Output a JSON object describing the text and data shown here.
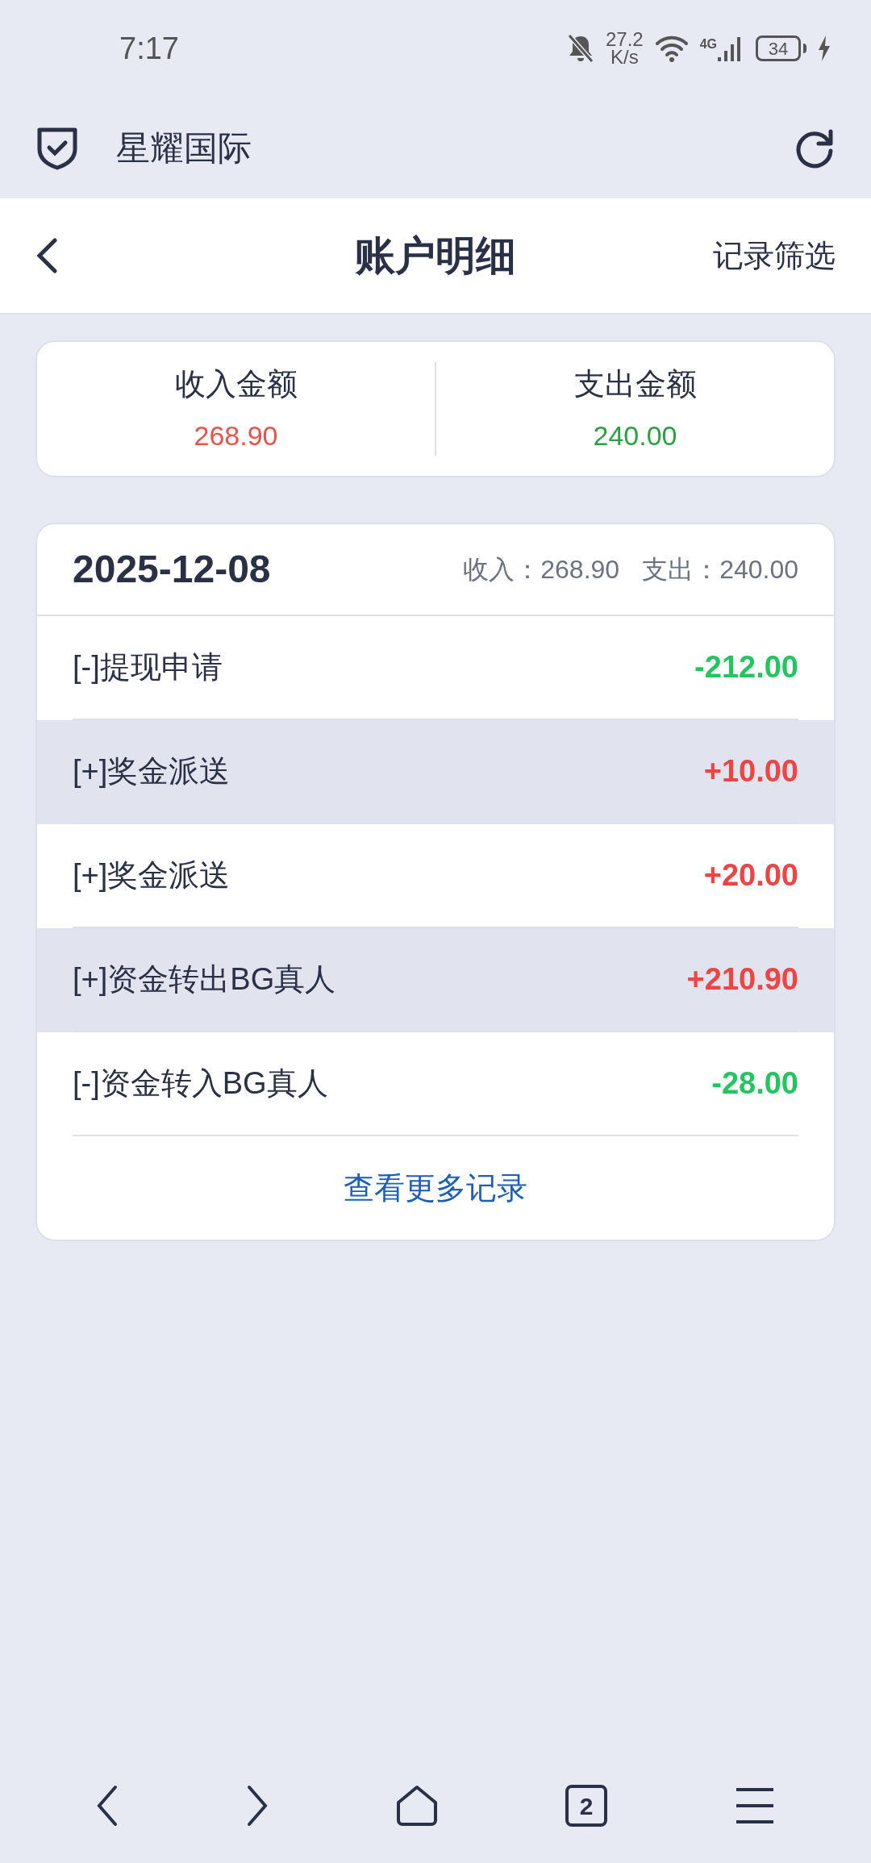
{
  "status_bar": {
    "time": "7:17",
    "speed": "27.2",
    "speed_unit": "K/s",
    "network": "4G",
    "battery": "34"
  },
  "browser_bar": {
    "title": "星耀国际"
  },
  "header": {
    "title": "账户明细",
    "action": "记录筛选"
  },
  "summary": [
    {
      "label": "收入金额",
      "value": "268.90",
      "kind": "income"
    },
    {
      "label": "支出金额",
      "value": "240.00",
      "kind": "expense"
    }
  ],
  "day": {
    "date": "2025-12-08",
    "income_label": "收入：",
    "income": "268.90",
    "expense_label": "支出：",
    "expense": "240.00"
  },
  "records": [
    {
      "name": "[-]提现申请",
      "amount": "-212.00",
      "kind": "expense",
      "shaded": false
    },
    {
      "name": "[+]奖金派送",
      "amount": "+10.00",
      "kind": "income",
      "shaded": true
    },
    {
      "name": "[+]奖金派送",
      "amount": "+20.00",
      "kind": "income",
      "shaded": false
    },
    {
      "name": "[+]资金转出BG真人",
      "amount": "+210.90",
      "kind": "income",
      "shaded": true
    },
    {
      "name": "[-]资金转入BG真人",
      "amount": "-28.00",
      "kind": "expense",
      "shaded": false
    }
  ],
  "more_link": "查看更多记录",
  "nav": {
    "tabs_count": "2"
  }
}
